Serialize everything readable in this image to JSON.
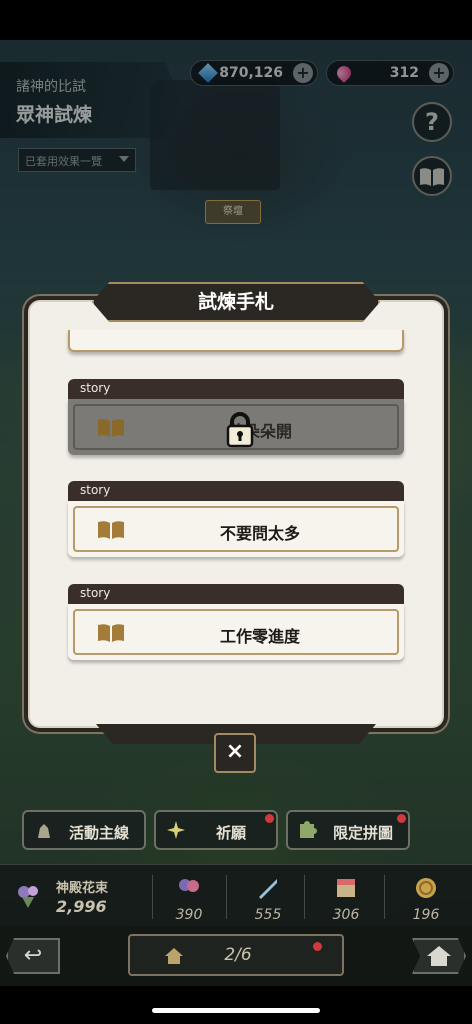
{
  "header": {
    "location_subtitle": "諸神的比試",
    "location_title": "眾神試煉",
    "effects_dropdown": "已套用效果一覽",
    "center_sign": "祭壇"
  },
  "currencies": [
    {
      "name": "gem",
      "amount": "870,126",
      "plus": "+"
    },
    {
      "name": "ruby",
      "amount": "312",
      "plus": "+"
    }
  ],
  "side_buttons": {
    "help_symbol": "?"
  },
  "modal": {
    "title": "試煉手札",
    "close_symbol": "×",
    "stories": [
      {
        "tag": "story",
        "label": "花朵朵開",
        "locked": true
      },
      {
        "tag": "story",
        "label": "不要問太多",
        "locked": false
      },
      {
        "tag": "story",
        "label": "工作零進度",
        "locked": false
      }
    ]
  },
  "actions": [
    {
      "label": "活動主線"
    },
    {
      "label": "祈願"
    },
    {
      "label": "限定拼圖"
    }
  ],
  "resources": {
    "main_label": "神殿花束",
    "main_value": "2,996",
    "items": [
      {
        "icon": "flower-bundle-icon",
        "value": "390"
      },
      {
        "icon": "sword-icon",
        "value": "555"
      },
      {
        "icon": "chest-icon",
        "value": "306"
      },
      {
        "icon": "coin-icon",
        "value": "196"
      }
    ]
  },
  "nav": {
    "page": "2/6",
    "back_symbol": "↩"
  },
  "colors": {
    "modal_bg": "#f2efe8",
    "card_border": "#b59a6a",
    "tag_bg": "#3a2e2a",
    "locked_bg": "#7c7a76",
    "frame_gold": "#a18b63",
    "notify_red": "#d13a3a"
  }
}
